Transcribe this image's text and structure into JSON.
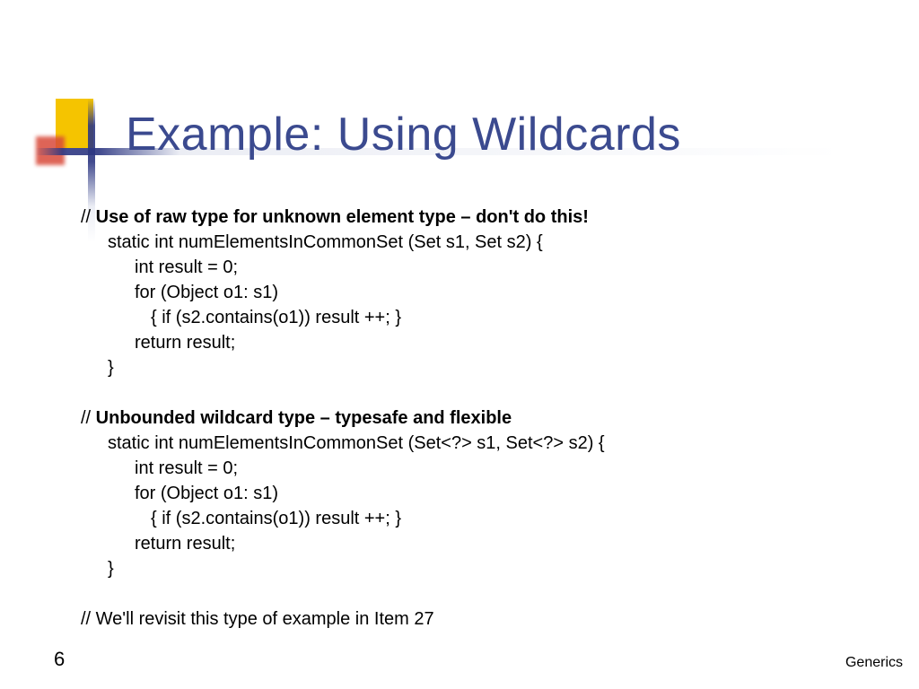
{
  "title": "Example: Using Wildcards",
  "comment1": "Use of raw type for unknown element type – don't do this!",
  "code1": {
    "l1": "static int numElementsInCommonSet (Set s1, Set s2) {",
    "l2": "int result = 0;",
    "l3": "for (Object o1: s1)",
    "l4": "{ if (s2.contains(o1)) result ++; }",
    "l5": "return result;",
    "l6": "}"
  },
  "comment2": "Unbounded wildcard type – typesafe and flexible",
  "code2": {
    "l1": "static int numElementsInCommonSet (Set<?> s1, Set<?> s2) {",
    "l2": "int result = 0;",
    "l3": "for (Object o1: s1)",
    "l4": "{ if (s2.contains(o1)) result ++; }",
    "l5": "return result;",
    "l6": "}"
  },
  "comment3": "// We'll revisit this type of example in Item 27",
  "page_number": "6",
  "footer": "Generics"
}
